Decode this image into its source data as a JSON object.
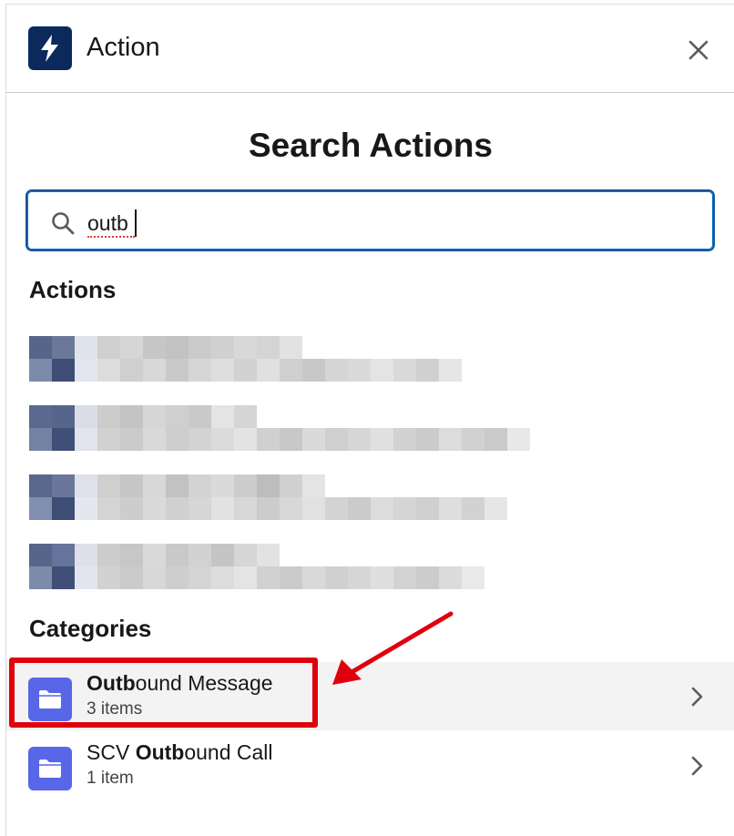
{
  "header": {
    "title": "Action",
    "icon": "lightning-bolt-icon",
    "close_icon": "close-icon"
  },
  "search": {
    "heading": "Search Actions",
    "value": "outb",
    "icon": "search-icon"
  },
  "sections": {
    "actions_label": "Actions",
    "categories_label": "Categories"
  },
  "categories": [
    {
      "match": "Outb",
      "rest": "ound Message",
      "prefix": "",
      "count": "3 items",
      "active": true
    },
    {
      "prefix": "SCV ",
      "match": "Outb",
      "rest": "ound Call",
      "count": "1 item",
      "active": false
    }
  ],
  "colors": {
    "header_icon_bg": "#0b2a5b",
    "folder_icon_bg": "#5867e8",
    "focus_border": "#1b5297",
    "annotation_red": "#e0000d"
  }
}
